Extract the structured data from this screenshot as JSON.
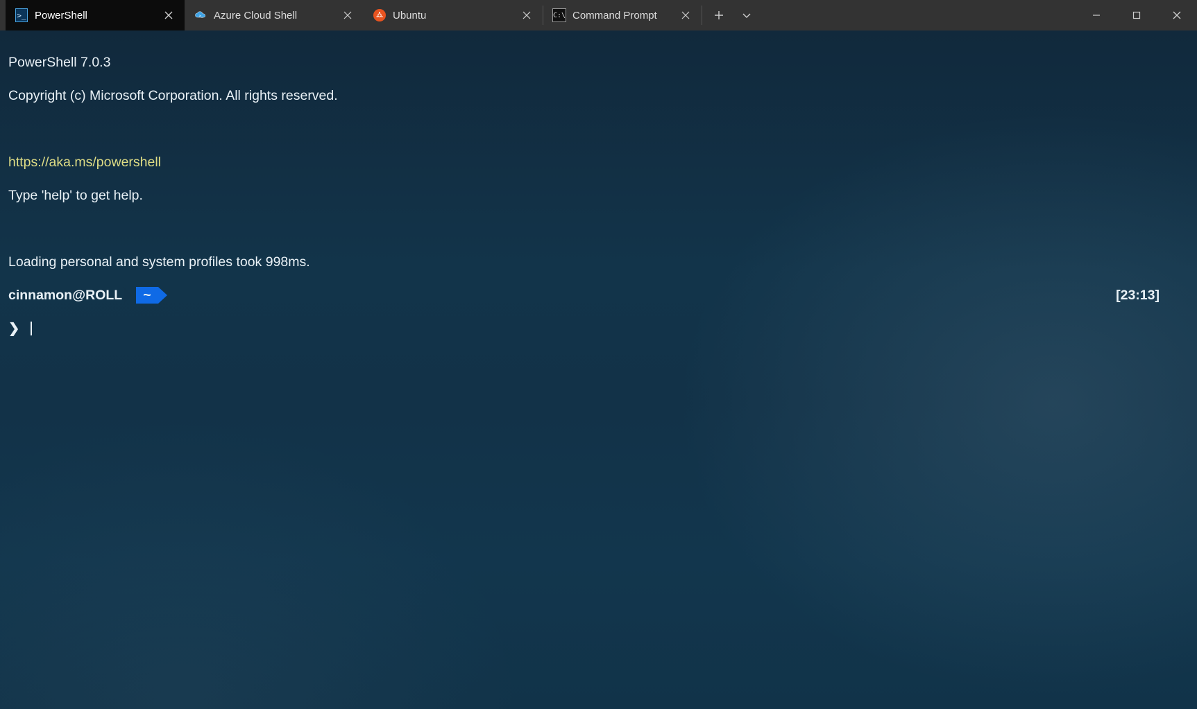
{
  "tabs": [
    {
      "label": "PowerShell",
      "icon": "powershell-icon",
      "active": true
    },
    {
      "label": "Azure Cloud Shell",
      "icon": "azure-cloud-icon",
      "active": false
    },
    {
      "label": "Ubuntu",
      "icon": "ubuntu-icon",
      "active": false
    },
    {
      "label": "Command Prompt",
      "icon": "command-prompt-icon",
      "active": false
    }
  ],
  "terminal": {
    "line1": "PowerShell 7.0.3",
    "line2": "Copyright (c) Microsoft Corporation. All rights reserved.",
    "line3": "https://aka.ms/powershell",
    "line4": "Type 'help' to get help.",
    "line5": "Loading personal and system profiles took 998ms.",
    "userhost": "cinnamon@ROLL",
    "path_segment": "~",
    "time": "[23:13]",
    "prompt_symbol": "❯",
    "input_value": ""
  }
}
